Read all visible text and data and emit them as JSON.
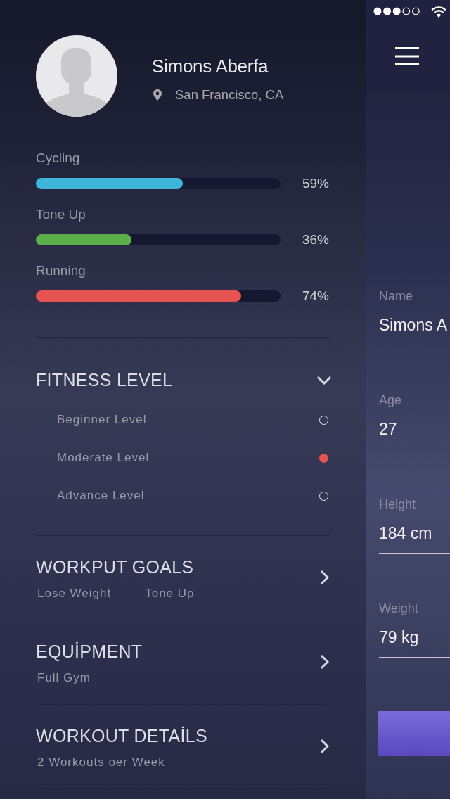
{
  "profile": {
    "name": "Simons Aberfa",
    "location": "San Francisco, CA"
  },
  "activities": [
    {
      "label": "Cycling",
      "level": 0.6,
      "reading": "59%",
      "color": "#3fb6d9"
    },
    {
      "label": "Tone Up",
      "level": 0.39,
      "reading": "36%",
      "color": "#5bb04a"
    },
    {
      "label": "Running",
      "level": 0.84,
      "reading": "74%",
      "color": "#e55353"
    }
  ],
  "fitness_level": {
    "title": "FITNESS LEVEL",
    "expanded": true,
    "options": [
      {
        "label": "Beginner Level",
        "selected": false
      },
      {
        "label": "Moderate Level",
        "selected": true
      },
      {
        "label": "Advance Level",
        "selected": false
      }
    ]
  },
  "sections": [
    {
      "title": "WORKPUT GOALS",
      "values": [
        "Lose Weight",
        "Tone Up"
      ]
    },
    {
      "title": "EQUİPMENT",
      "values": [
        "Full Gym"
      ]
    },
    {
      "title": "WORKOUT DETAİLS",
      "values": [
        "2 Workouts oer Week"
      ]
    }
  ],
  "form": {
    "fields": [
      {
        "label": "Name",
        "value": "Simons A"
      },
      {
        "label": "Age",
        "value": "27"
      },
      {
        "label": "Height",
        "value": "184 cm"
      },
      {
        "label": "Weight",
        "value": "79 kg"
      }
    ]
  }
}
